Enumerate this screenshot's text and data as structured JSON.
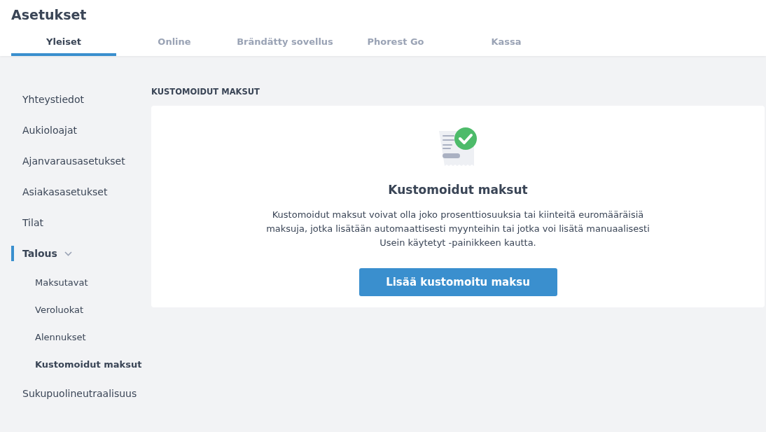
{
  "header": {
    "title": "Asetukset"
  },
  "tabs": [
    {
      "label": "Yleiset",
      "selected": true
    },
    {
      "label": "Online",
      "selected": false
    },
    {
      "label": "Brändätty sovellus",
      "selected": false
    },
    {
      "label": "Phorest Go",
      "selected": false
    },
    {
      "label": "Kassa",
      "selected": false
    }
  ],
  "sidebar": {
    "items": [
      {
        "label": "Yhteystiedot",
        "selected": false
      },
      {
        "label": "Aukioloajat",
        "selected": false
      },
      {
        "label": "Ajanvarausasetukset",
        "selected": false
      },
      {
        "label": "Asiakasasetukset",
        "selected": false
      },
      {
        "label": "Tilat",
        "selected": false
      },
      {
        "label": "Talous",
        "selected": true,
        "expanded": true,
        "children": [
          {
            "label": "Maksutavat",
            "selected": false
          },
          {
            "label": "Veroluokat",
            "selected": false
          },
          {
            "label": "Alennukset",
            "selected": false
          },
          {
            "label": "Kustomoidut maksut",
            "selected": true
          }
        ]
      },
      {
        "label": "Sukupuolineutraalisuus",
        "selected": false
      }
    ]
  },
  "section": {
    "heading": "KUSTOMOIDUT MAKSUT",
    "card": {
      "title": "Kustomoidut maksut",
      "description": "Kustomoidut maksut voivat olla joko prosenttiosuuksia tai kiinteitä euromääräisiä maksuja, jotka lisätään automaattisesti myynteihin tai jotka voi lisätä manuaalisesti Usein käytetyt -painikkeen kautta.",
      "button": "Lisää kustomoitu maksu"
    }
  }
}
